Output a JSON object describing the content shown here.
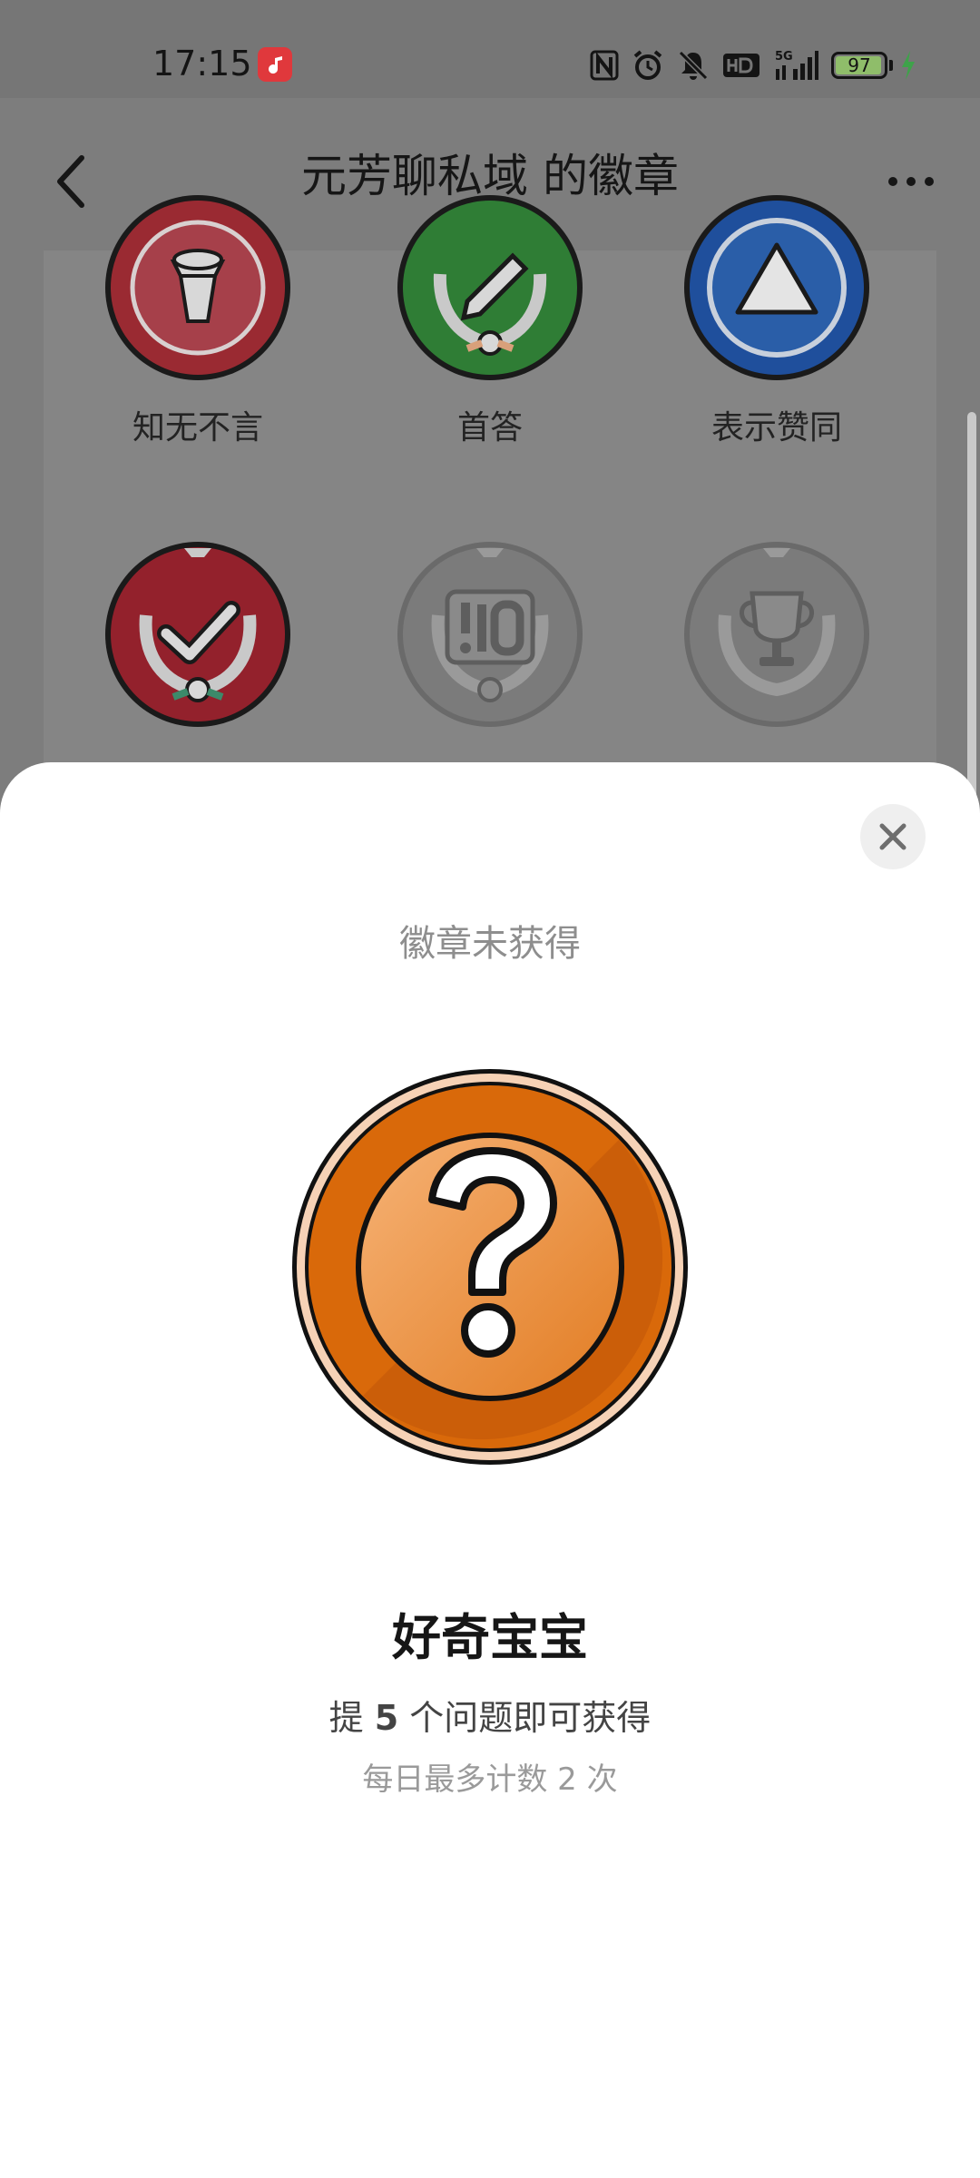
{
  "status_bar": {
    "time": "17:15",
    "battery": "97",
    "icons": [
      "music-app-icon",
      "nfc-icon",
      "alarm-icon",
      "mute-icon",
      "hd-icon",
      "5g-signal-icon",
      "battery-icon",
      "charging-icon"
    ]
  },
  "header": {
    "title": "元芳聊私域 的徽章",
    "back_icon": "chevron-left-icon",
    "more_icon": "more-dots-icon"
  },
  "badges": [
    {
      "label": "知无不言",
      "color": "#9a2a32",
      "icon": "microphone-icon",
      "earned": true
    },
    {
      "label": "首答",
      "color": "#2f7d35",
      "icon": "pencil-icon",
      "earned": true
    },
    {
      "label": "表示赞同",
      "color": "#1f4f9c",
      "icon": "triangle-icon",
      "earned": true
    },
    {
      "label": "",
      "color": "#93212c",
      "icon": "checkmark-icon",
      "earned": true
    },
    {
      "label": "",
      "color": "#7b7b7b",
      "icon": "ten-icon",
      "earned": false
    },
    {
      "label": "",
      "color": "#7b7b7b",
      "icon": "trophy-icon",
      "earned": false
    }
  ],
  "sheet": {
    "status": "徽章未获得",
    "badge_name": "好奇宝宝",
    "requirement_prefix": "提 ",
    "requirement_count": "5",
    "requirement_suffix": " 个问题即可获得",
    "limit": "每日最多计数 2 次",
    "badge_icon": "question-mark-icon",
    "badge_color": "#e07a1c",
    "close_icon": "close-icon"
  }
}
